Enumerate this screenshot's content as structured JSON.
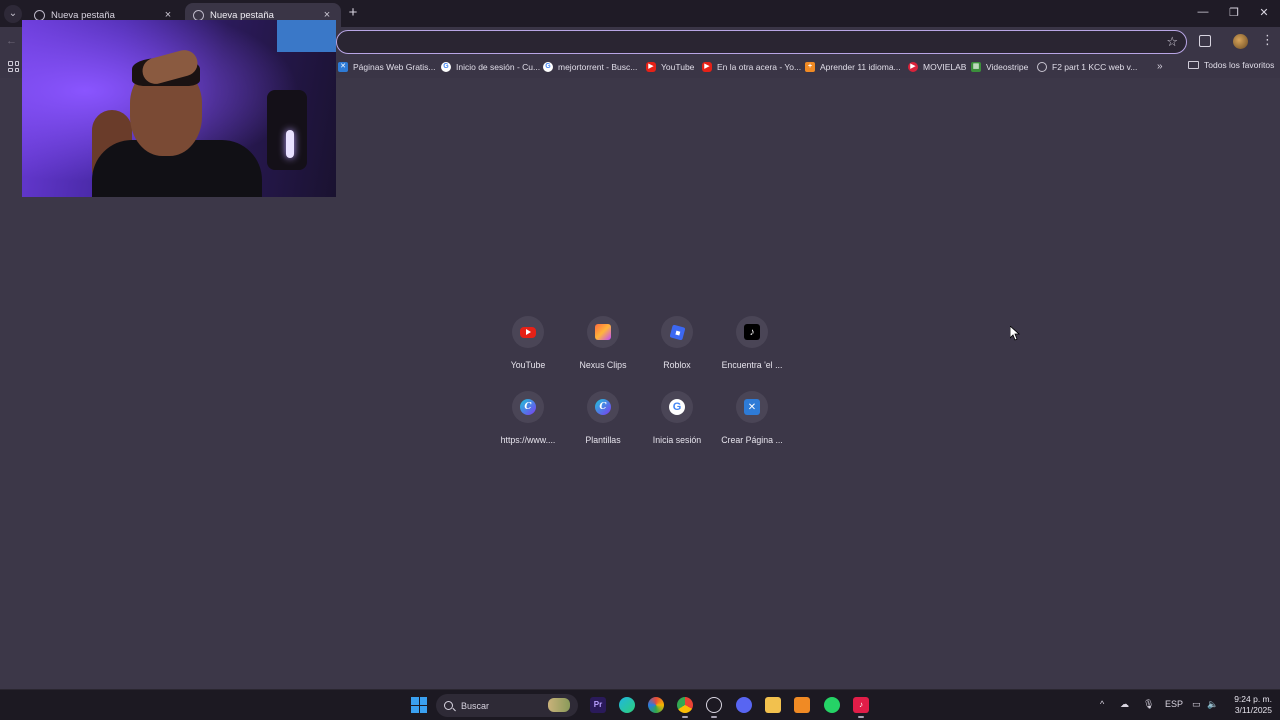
{
  "tabs": [
    {
      "title": "Nueva pestaña",
      "active": false
    },
    {
      "title": "Nueva pestaña",
      "active": true
    }
  ],
  "tab_close_glyph": "×",
  "new_tab_glyph": "+",
  "window_controls": {
    "minimize": "—",
    "restore": "❐",
    "close": "✕"
  },
  "toolbar": {
    "back": "←",
    "star": "☆",
    "menu": "⋮"
  },
  "omnibox": {
    "value": ""
  },
  "bookmarks": [
    {
      "label": "Páginas Web Gratis...",
      "icon": "x-icon"
    },
    {
      "label": "Inicio de sesión - Cu...",
      "icon": "google-icon"
    },
    {
      "label": "mejortorrent - Busc...",
      "icon": "google-icon"
    },
    {
      "label": "YouTube",
      "icon": "youtube-icon"
    },
    {
      "label": "En la otra acera - Yo...",
      "icon": "youtube-icon"
    },
    {
      "label": "Aprender 11 idioma...",
      "icon": "orange-icon"
    },
    {
      "label": "MOVIELAB",
      "icon": "red-icon"
    },
    {
      "label": "Videostripe",
      "icon": "green-icon"
    },
    {
      "label": "F2 part 1 KCC web v...",
      "icon": "globe-icon"
    }
  ],
  "bookmarks_more": "»",
  "all_favorites": "Todos los favoritos",
  "shortcuts": [
    {
      "label": "YouTube",
      "icon": "youtube-icon"
    },
    {
      "label": "Nexus Clips",
      "icon": "nexus-clips-icon"
    },
    {
      "label": "Roblox",
      "icon": "roblox-icon"
    },
    {
      "label": "Encuentra 'el ...",
      "icon": "tiktok-icon"
    },
    {
      "label": "https://www....",
      "icon": "canva-icon"
    },
    {
      "label": "Plantillas",
      "icon": "canva-icon"
    },
    {
      "label": "Inicia sesión",
      "icon": "google-icon"
    },
    {
      "label": "Crear Página ...",
      "icon": "x-icon"
    }
  ],
  "taskbar": {
    "search_placeholder": "Buscar",
    "language": "ESP",
    "time": "9:24 p. m.",
    "date": "3/11/2025"
  },
  "colors": {
    "page_bg": "#3c3748",
    "tabstrip_bg": "#1f1b26",
    "toolbar_bg": "#3a3546",
    "omnibox_border": "#b9a6e6",
    "taskbar_bg": "#1c1922"
  }
}
